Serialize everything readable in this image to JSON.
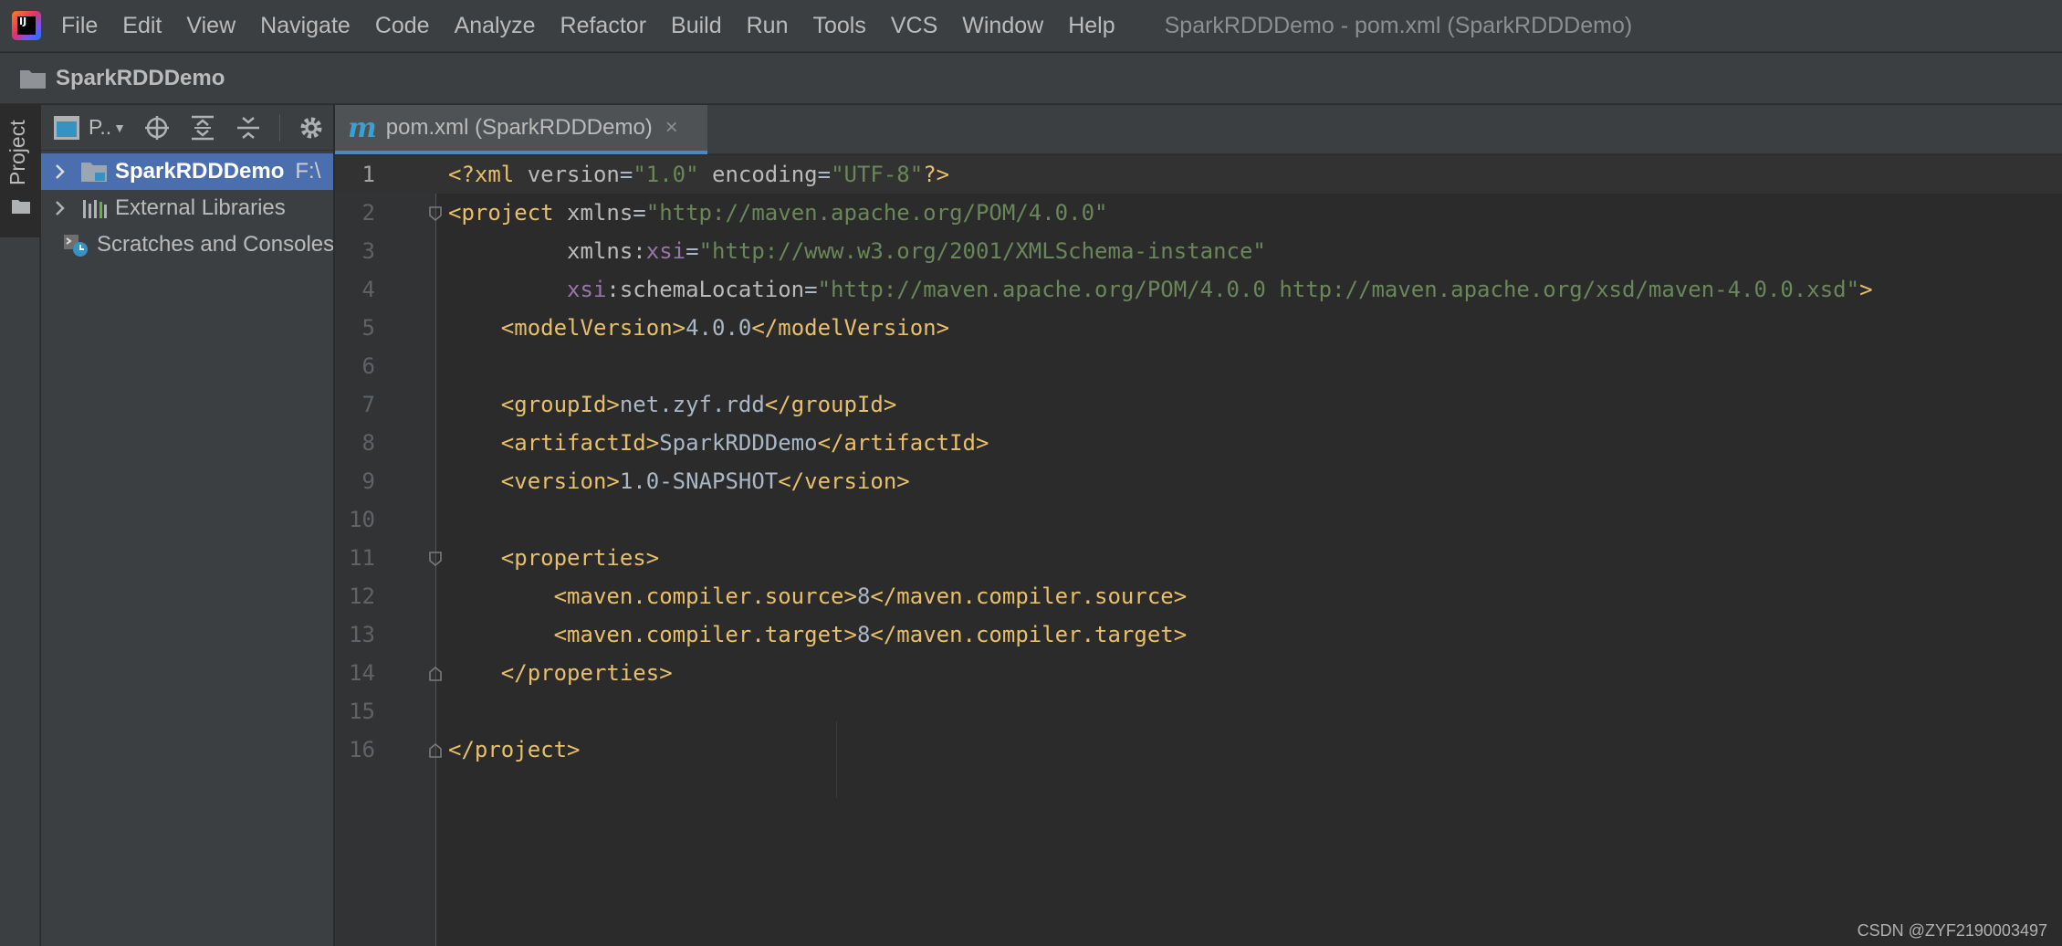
{
  "menu": {
    "app_logo_label": "IJ",
    "items": [
      "File",
      "Edit",
      "View",
      "Navigate",
      "Code",
      "Analyze",
      "Refactor",
      "Build",
      "Run",
      "Tools",
      "VCS",
      "Window",
      "Help"
    ],
    "window_title": "SparkRDDDemo - pom.xml (SparkRDDDemo)"
  },
  "navbar": {
    "project_name": "SparkRDDDemo"
  },
  "stripe": {
    "project_tab": "Project"
  },
  "project_panel": {
    "view_label": "P..",
    "tree": [
      {
        "label": "SparkRDDDemo",
        "path": "F:\\",
        "expandable": true,
        "selected": true,
        "icon": "module-folder-icon"
      },
      {
        "label": "External Libraries",
        "path": "",
        "expandable": true,
        "selected": false,
        "icon": "library-icon"
      },
      {
        "label": "Scratches and Consoles",
        "path": "",
        "expandable": false,
        "selected": false,
        "icon": "scratches-icon"
      }
    ]
  },
  "editor": {
    "tab_icon": "m",
    "tab_label": "pom.xml (SparkRDDDemo)",
    "tab_close": "×",
    "current_line": 1,
    "lines": [
      {
        "n": "1",
        "tokens": [
          [
            "t-tag",
            "<?xml "
          ],
          [
            "t-attr",
            "version"
          ],
          [
            "t-text",
            "="
          ],
          [
            "t-val",
            "\"1.0\""
          ],
          [
            "t-attr",
            " encoding"
          ],
          [
            "t-text",
            "="
          ],
          [
            "t-val",
            "\"UTF-8\""
          ],
          [
            "t-tag",
            "?>"
          ]
        ]
      },
      {
        "n": "2",
        "fold": "open",
        "tokens": [
          [
            "t-tag",
            "<project "
          ],
          [
            "t-attr",
            "xmlns"
          ],
          [
            "t-text",
            "="
          ],
          [
            "t-val",
            "\"http://maven.apache.org/POM/4.0.0\""
          ]
        ]
      },
      {
        "n": "3",
        "tokens": [
          [
            "t-attr",
            "         xmlns:"
          ],
          [
            "t-ns",
            "xsi"
          ],
          [
            "t-text",
            "="
          ],
          [
            "t-val",
            "\"http://www.w3.org/2001/XMLSchema-instance\""
          ]
        ]
      },
      {
        "n": "4",
        "tokens": [
          [
            "t-ns",
            "         xsi"
          ],
          [
            "t-attr",
            ":schemaLocation"
          ],
          [
            "t-text",
            "="
          ],
          [
            "t-val",
            "\"http://maven.apache.org/POM/4.0.0 http://maven.apache.org/xsd/maven-4.0.0.xsd\""
          ],
          [
            "t-tag",
            ">"
          ]
        ]
      },
      {
        "n": "5",
        "tokens": [
          [
            "t-tag",
            "    <modelVersion>"
          ],
          [
            "t-text",
            "4.0.0"
          ],
          [
            "t-tag",
            "</modelVersion>"
          ]
        ]
      },
      {
        "n": "6",
        "tokens": []
      },
      {
        "n": "7",
        "tokens": [
          [
            "t-tag",
            "    <groupId>"
          ],
          [
            "t-text",
            "net.zyf.rdd"
          ],
          [
            "t-tag",
            "</groupId>"
          ]
        ]
      },
      {
        "n": "8",
        "tokens": [
          [
            "t-tag",
            "    <artifactId>"
          ],
          [
            "t-text",
            "SparkRDDDemo"
          ],
          [
            "t-tag",
            "</artifactId>"
          ]
        ]
      },
      {
        "n": "9",
        "tokens": [
          [
            "t-tag",
            "    <version>"
          ],
          [
            "t-text",
            "1.0-SNAPSHOT"
          ],
          [
            "t-tag",
            "</version>"
          ]
        ]
      },
      {
        "n": "10",
        "tokens": []
      },
      {
        "n": "11",
        "fold": "open",
        "tokens": [
          [
            "t-tag",
            "    <properties>"
          ]
        ]
      },
      {
        "n": "12",
        "tokens": [
          [
            "t-tag",
            "        <maven.compiler.source>"
          ],
          [
            "t-text",
            "8"
          ],
          [
            "t-tag",
            "</maven.compiler.source>"
          ]
        ]
      },
      {
        "n": "13",
        "tokens": [
          [
            "t-tag",
            "        <maven.compiler.target>"
          ],
          [
            "t-text",
            "8"
          ],
          [
            "t-tag",
            "</maven.compiler.target>"
          ]
        ]
      },
      {
        "n": "14",
        "fold": "close",
        "tokens": [
          [
            "t-tag",
            "    </properties>"
          ]
        ]
      },
      {
        "n": "15",
        "tokens": []
      },
      {
        "n": "16",
        "fold": "close",
        "tokens": [
          [
            "t-tag",
            "</project>"
          ]
        ]
      }
    ]
  },
  "watermark": "CSDN @ZYF2190003497",
  "colors": {
    "accent": "#4a88c7",
    "selection": "#4b6eaf",
    "tag": "#e8bf6a",
    "string": "#6a8759",
    "namespace": "#9876aa"
  }
}
